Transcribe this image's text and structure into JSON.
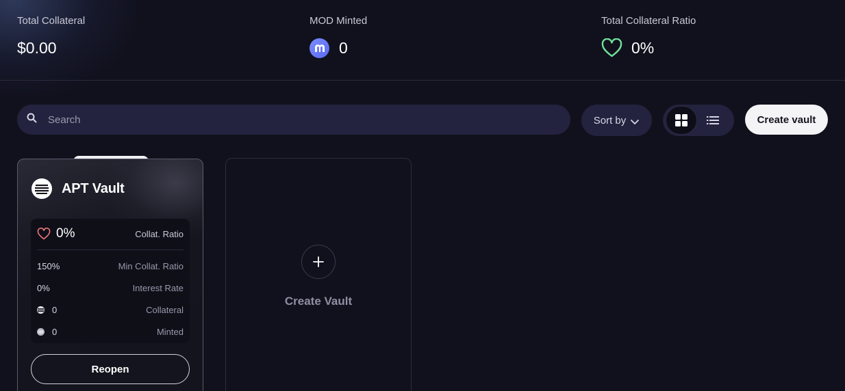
{
  "stats": {
    "total_collateral": {
      "label": "Total Collateral",
      "value": "$0.00"
    },
    "mod_minted": {
      "label": "MOD Minted",
      "value": "0",
      "icon": "mod-token-icon"
    },
    "collateral_ratio": {
      "label": "Total Collateral Ratio",
      "value": "0%",
      "icon": "heart-icon",
      "icon_color": "#6ee39a"
    }
  },
  "toolbar": {
    "search_placeholder": "Search",
    "sort_label": "Sort by",
    "view_modes": [
      "grid",
      "list"
    ],
    "active_view": "grid",
    "create_label": "Create vault"
  },
  "vault": {
    "title": "APT Vault",
    "icon": "aptos-logo-icon",
    "collat_ratio_value": "0%",
    "collat_ratio_label": "Collat. Ratio",
    "heart_color": "#f07a7a",
    "rows": [
      {
        "value": "150%",
        "label": "Min Collat. Ratio"
      },
      {
        "value": "0%",
        "label": "Interest Rate"
      },
      {
        "value": "0",
        "label": "Collateral",
        "icon": "aptos-icon"
      },
      {
        "value": "0",
        "label": "Minted",
        "icon": "mod-icon"
      }
    ],
    "reopen_label": "Reopen"
  },
  "create_card": {
    "label": "Create Vault"
  },
  "colors": {
    "background": "#11111d",
    "panel": "#23233f",
    "accent_mod": "#6b7cf5",
    "ratio_green": "#6ee39a"
  }
}
